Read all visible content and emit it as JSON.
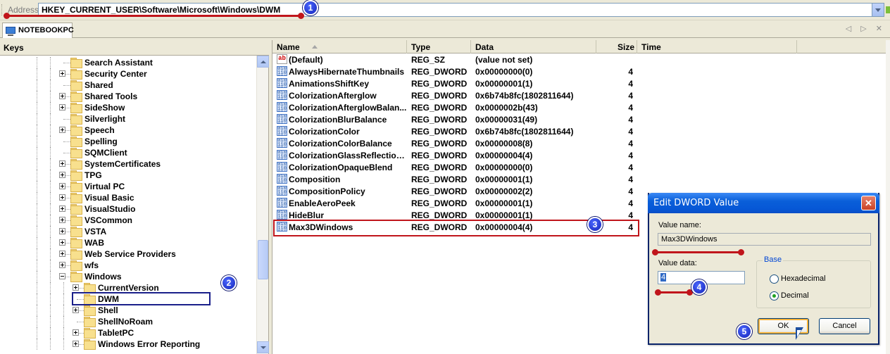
{
  "address": {
    "label": "Address",
    "value": "HKEY_CURRENT_USER\\Software\\Microsoft\\Windows\\DWM"
  },
  "document_tab": {
    "label": "NOTEBOOKPC",
    "controls": "◁ ▷ ✕"
  },
  "keys_pane": {
    "title": "Keys",
    "items": [
      {
        "label": "Search Assistant",
        "level": 0,
        "expander": "none"
      },
      {
        "label": "Security Center",
        "level": 0,
        "expander": "plus"
      },
      {
        "label": "Shared",
        "level": 0,
        "expander": "none"
      },
      {
        "label": "Shared Tools",
        "level": 0,
        "expander": "plus"
      },
      {
        "label": "SideShow",
        "level": 0,
        "expander": "plus"
      },
      {
        "label": "Silverlight",
        "level": 0,
        "expander": "none"
      },
      {
        "label": "Speech",
        "level": 0,
        "expander": "plus"
      },
      {
        "label": "Spelling",
        "level": 0,
        "expander": "none"
      },
      {
        "label": "SQMClient",
        "level": 0,
        "expander": "none"
      },
      {
        "label": "SystemCertificates",
        "level": 0,
        "expander": "plus"
      },
      {
        "label": "TPG",
        "level": 0,
        "expander": "plus"
      },
      {
        "label": "Virtual PC",
        "level": 0,
        "expander": "plus"
      },
      {
        "label": "Visual Basic",
        "level": 0,
        "expander": "plus"
      },
      {
        "label": "VisualStudio",
        "level": 0,
        "expander": "plus"
      },
      {
        "label": "VSCommon",
        "level": 0,
        "expander": "plus"
      },
      {
        "label": "VSTA",
        "level": 0,
        "expander": "plus"
      },
      {
        "label": "WAB",
        "level": 0,
        "expander": "plus"
      },
      {
        "label": "Web Service Providers",
        "level": 0,
        "expander": "plus"
      },
      {
        "label": "wfs",
        "level": 0,
        "expander": "plus"
      },
      {
        "label": "Windows",
        "level": 0,
        "expander": "minus"
      },
      {
        "label": "CurrentVersion",
        "level": 1,
        "expander": "plus"
      },
      {
        "label": "DWM",
        "level": 1,
        "expander": "none",
        "selected": true
      },
      {
        "label": "Shell",
        "level": 1,
        "expander": "plus"
      },
      {
        "label": "ShellNoRoam",
        "level": 1,
        "expander": "none"
      },
      {
        "label": "TabletPC",
        "level": 1,
        "expander": "plus"
      },
      {
        "label": "Windows Error Reporting",
        "level": 1,
        "expander": "plus"
      }
    ]
  },
  "values_pane": {
    "columns": [
      "Name",
      "Type",
      "Data",
      "Size",
      "Time"
    ],
    "sorted_column": "Name",
    "rows": [
      {
        "icon": "string-value-icon",
        "name": "(Default)",
        "type": "REG_SZ",
        "data": "(value not set)",
        "size": ""
      },
      {
        "icon": "dword-value-icon",
        "name": "AlwaysHibernateThumbnails",
        "type": "REG_DWORD",
        "data": "0x00000000(0)",
        "size": "4"
      },
      {
        "icon": "dword-value-icon",
        "name": "AnimationsShiftKey",
        "type": "REG_DWORD",
        "data": "0x00000001(1)",
        "size": "4"
      },
      {
        "icon": "dword-value-icon",
        "name": "ColorizationAfterglow",
        "type": "REG_DWORD",
        "data": "0x6b74b8fc(1802811644)",
        "size": "4"
      },
      {
        "icon": "dword-value-icon",
        "name": "ColorizationAfterglowBalan...",
        "type": "REG_DWORD",
        "data": "0x0000002b(43)",
        "size": "4"
      },
      {
        "icon": "dword-value-icon",
        "name": "ColorizationBlurBalance",
        "type": "REG_DWORD",
        "data": "0x00000031(49)",
        "size": "4"
      },
      {
        "icon": "dword-value-icon",
        "name": "ColorizationColor",
        "type": "REG_DWORD",
        "data": "0x6b74b8fc(1802811644)",
        "size": "4"
      },
      {
        "icon": "dword-value-icon",
        "name": "ColorizationColorBalance",
        "type": "REG_DWORD",
        "data": "0x00000008(8)",
        "size": "4"
      },
      {
        "icon": "dword-value-icon",
        "name": "ColorizationGlassReflection...",
        "type": "REG_DWORD",
        "data": "0x00000004(4)",
        "size": "4"
      },
      {
        "icon": "dword-value-icon",
        "name": "ColorizationOpaqueBlend",
        "type": "REG_DWORD",
        "data": "0x00000000(0)",
        "size": "4"
      },
      {
        "icon": "dword-value-icon",
        "name": "Composition",
        "type": "REG_DWORD",
        "data": "0x00000001(1)",
        "size": "4"
      },
      {
        "icon": "dword-value-icon",
        "name": "CompositionPolicy",
        "type": "REG_DWORD",
        "data": "0x00000002(2)",
        "size": "4"
      },
      {
        "icon": "dword-value-icon",
        "name": "EnableAeroPeek",
        "type": "REG_DWORD",
        "data": "0x00000001(1)",
        "size": "4"
      },
      {
        "icon": "dword-value-icon",
        "name": "HideBlur",
        "type": "REG_DWORD",
        "data": "0x00000001(1)",
        "size": "4"
      },
      {
        "icon": "dword-value-icon",
        "name": "Max3DWindows",
        "type": "REG_DWORD",
        "data": "0x00000004(4)",
        "size": "4",
        "highlighted": true
      }
    ]
  },
  "dialog": {
    "title": "Edit DWORD Value",
    "value_name_label": "Value name:",
    "value_name": "Max3DWindows",
    "value_data_label": "Value data:",
    "value_data": "4",
    "base_label": "Base",
    "base_options": [
      {
        "label": "Hexadecimal",
        "selected": false
      },
      {
        "label": "Decimal",
        "selected": true
      }
    ],
    "ok_label": "OK",
    "cancel_label": "Cancel"
  },
  "annotations": {
    "badges": [
      "1",
      "2",
      "3",
      "4",
      "5"
    ],
    "marker_color": "#c0151b",
    "badge_color": "#1524b8",
    "selection_box_color": "#1a1f8a"
  }
}
